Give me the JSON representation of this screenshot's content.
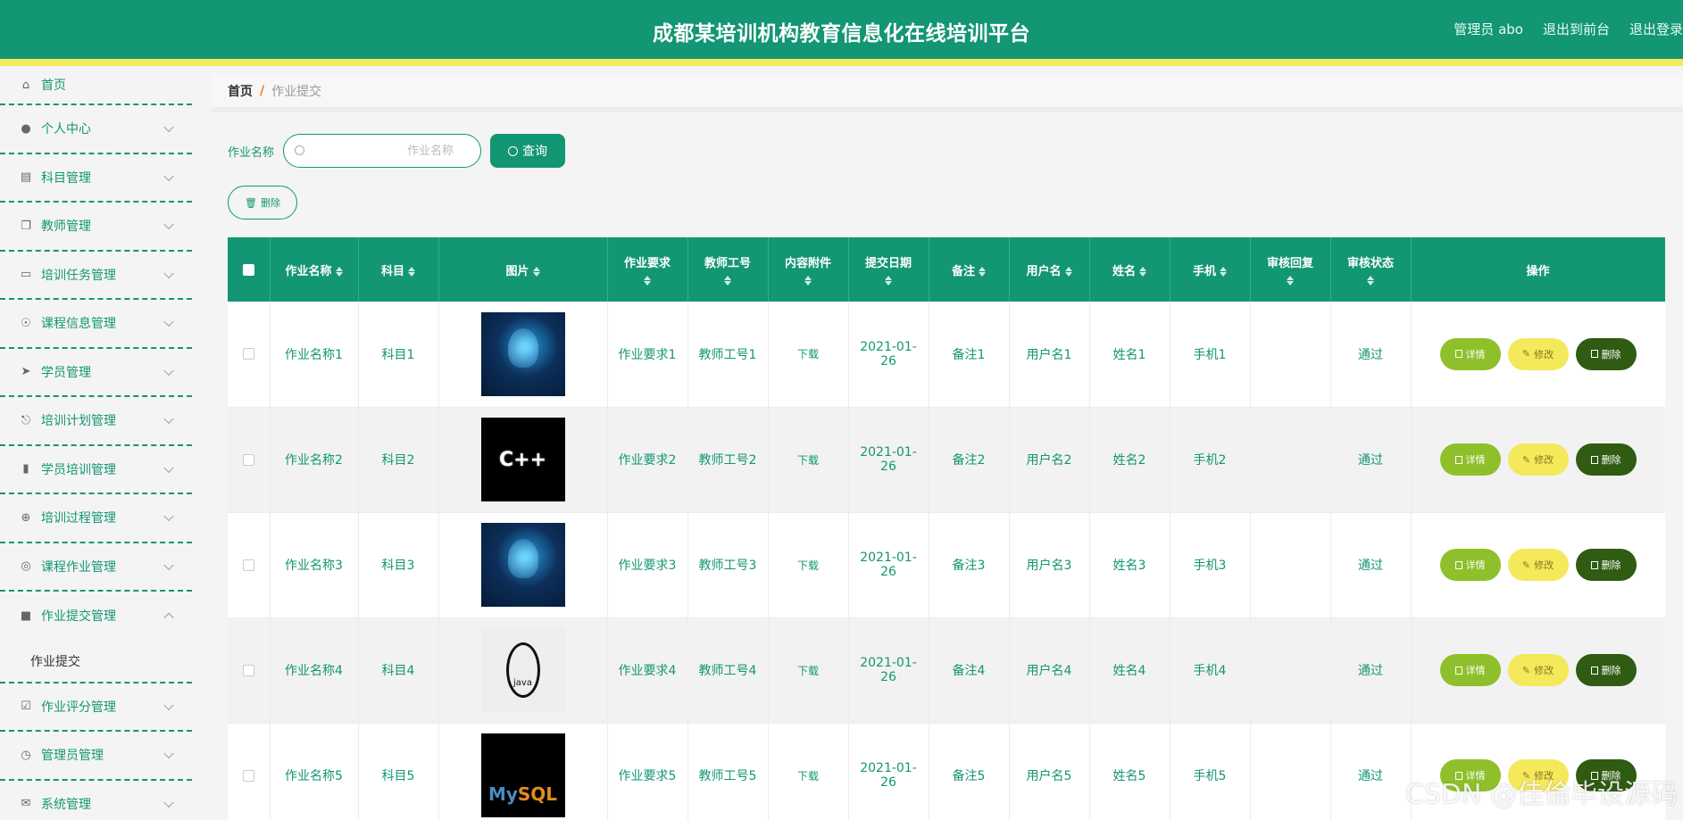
{
  "header": {
    "title": "成都某培训机构教育信息化在线培训平台",
    "user": "管理员 abo",
    "to_front": "退出到前台",
    "logout": "退出登录"
  },
  "sidebar": {
    "items": [
      {
        "label": "首页",
        "icon": "home-icon"
      },
      {
        "label": "个人中心",
        "icon": "user-icon"
      },
      {
        "label": "科目管理",
        "icon": "clipboard-icon"
      },
      {
        "label": "教师管理",
        "icon": "copy-icon"
      },
      {
        "label": "培训任务管理",
        "icon": "monitor-icon"
      },
      {
        "label": "课程信息管理",
        "icon": "bell-off-icon"
      },
      {
        "label": "学员管理",
        "icon": "send-icon"
      },
      {
        "label": "培训计划管理",
        "icon": "microphone-icon"
      },
      {
        "label": "学员培训管理",
        "icon": "ticket-icon"
      },
      {
        "label": "培训过程管理",
        "icon": "compass-icon"
      },
      {
        "label": "课程作业管理",
        "icon": "headset-icon"
      },
      {
        "label": "作业提交管理",
        "icon": "stamp-icon"
      },
      {
        "label": "作业评分管理",
        "icon": "checklist-icon"
      },
      {
        "label": "管理员管理",
        "icon": "clock-icon"
      },
      {
        "label": "系统管理",
        "icon": "mail-icon"
      }
    ],
    "submenu": {
      "label": "作业提交"
    }
  },
  "breadcrumb": {
    "home": "首页",
    "separator": "/",
    "current": "作业提交"
  },
  "search": {
    "label": "作业名称",
    "placeholder": "作业名称",
    "button": "查询"
  },
  "toolbar": {
    "delete_label": "删除"
  },
  "table": {
    "headers": {
      "name": "作业名称",
      "subject": "科目",
      "image": "图片",
      "requirement": "作业要求",
      "teacher_no": "教师工号",
      "attachment": "内容附件",
      "date": "提交日期",
      "remark": "备注",
      "username": "用户名",
      "realname": "姓名",
      "phone": "手机",
      "reply": "审核回复",
      "status": "审核状态",
      "ops": "操作"
    },
    "rows": [
      {
        "name": "作业名称1",
        "subject": "科目1",
        "image": "ai-head",
        "requirement": "作业要求1",
        "teacher_no": "教师工号1",
        "attachment": "下载",
        "date": "2021-01-26",
        "remark": "备注1",
        "username": "用户名1",
        "realname": "姓名1",
        "phone": "手机1",
        "reply": "",
        "status": "通过"
      },
      {
        "name": "作业名称2",
        "subject": "科目2",
        "image": "cpp-logo",
        "requirement": "作业要求2",
        "teacher_no": "教师工号2",
        "attachment": "下载",
        "date": "2021-01-26",
        "remark": "备注2",
        "username": "用户名2",
        "realname": "姓名2",
        "phone": "手机2",
        "reply": "",
        "status": "通过"
      },
      {
        "name": "作业名称3",
        "subject": "科目3",
        "image": "ai-head",
        "requirement": "作业要求3",
        "teacher_no": "教师工号3",
        "attachment": "下载",
        "date": "2021-01-26",
        "remark": "备注3",
        "username": "用户名3",
        "realname": "姓名3",
        "phone": "手机3",
        "reply": "",
        "status": "通过"
      },
      {
        "name": "作业名称4",
        "subject": "科目4",
        "image": "java-logo",
        "requirement": "作业要求4",
        "teacher_no": "教师工号4",
        "attachment": "下载",
        "date": "2021-01-26",
        "remark": "备注4",
        "username": "用户名4",
        "realname": "姓名4",
        "phone": "手机4",
        "reply": "",
        "status": "通过"
      },
      {
        "name": "作业名称5",
        "subject": "科目5",
        "image": "mysql-logo",
        "requirement": "作业要求5",
        "teacher_no": "教师工号5",
        "attachment": "下载",
        "date": "2021-01-26",
        "remark": "备注5",
        "username": "用户名5",
        "realname": "姓名5",
        "phone": "手机5",
        "reply": "",
        "status": "通过"
      }
    ],
    "actions": {
      "detail": "详情",
      "edit": "修改",
      "delete": "删除"
    },
    "image_text": {
      "cpp": "C++",
      "java": "java",
      "mysql_my": "My",
      "mysql_sql": "SQL"
    }
  },
  "watermark": "CSDN @佳倫毕设源码",
  "colors": {
    "primary": "#139673",
    "accent_yellow": "#f4e85b",
    "detail_green": "#8fbf2a",
    "delete_dark": "#2f5b12"
  }
}
